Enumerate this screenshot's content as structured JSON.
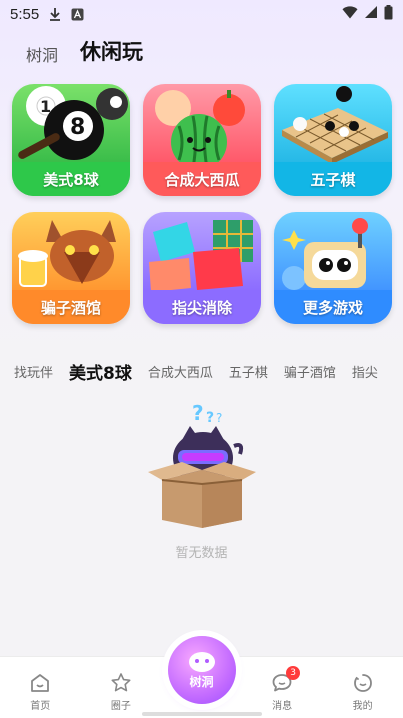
{
  "status_bar": {
    "time": "5:55"
  },
  "header": {
    "tabs": [
      {
        "label": "树洞"
      },
      {
        "label": "休闲玩"
      }
    ]
  },
  "games": [
    {
      "label": "美式8球",
      "color": "#2ec84a"
    },
    {
      "label": "合成大西瓜",
      "color": "#ff5a5a"
    },
    {
      "label": "五子棋",
      "color": "#12b6e6"
    },
    {
      "label": "骗子酒馆",
      "color": "#ff8a2a"
    },
    {
      "label": "指尖消除",
      "color": "#8c6cff"
    },
    {
      "label": "更多游戏",
      "color": "#2f8cff"
    }
  ],
  "sub_tabs": [
    {
      "label": "找玩伴"
    },
    {
      "label": "美式8球"
    },
    {
      "label": "合成大西瓜"
    },
    {
      "label": "五子棋"
    },
    {
      "label": "骗子酒馆"
    },
    {
      "label": "指尖"
    }
  ],
  "empty_state": {
    "text": "暂无数据"
  },
  "bottom_nav": {
    "items": [
      {
        "label": "首页"
      },
      {
        "label": "圈子"
      },
      {
        "label": "树洞"
      },
      {
        "label": "消息",
        "badge": "3"
      },
      {
        "label": "我的"
      }
    ]
  }
}
